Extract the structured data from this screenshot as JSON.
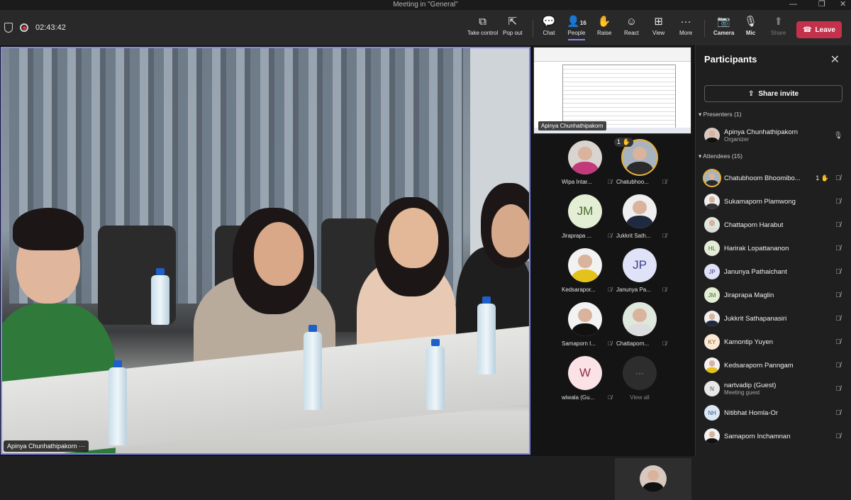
{
  "window": {
    "title": "Meeting in \"General\""
  },
  "toolbar": {
    "timer": "02:43:42",
    "buttons": {
      "take_control": "Take control",
      "pop_out": "Pop out",
      "chat": "Chat",
      "people": "People",
      "people_count": "16",
      "raise": "Raise",
      "react": "React",
      "view": "View",
      "more": "More",
      "camera": "Camera",
      "mic": "Mic",
      "share": "Share",
      "leave": "Leave"
    }
  },
  "main_video": {
    "name": "Apinya Chunhathipakorn"
  },
  "shared_screen": {
    "label": "Apinya Chunhathipakorn"
  },
  "gallery": [
    {
      "name": "Wipa Intar...",
      "initials": "",
      "raised": false,
      "hand_count": ""
    },
    {
      "name": "Chatubhoo...",
      "initials": "",
      "raised": true,
      "hand_count": "1"
    },
    {
      "name": "Jiraprapa ...",
      "initials": "JM",
      "raised": false,
      "hand_count": ""
    },
    {
      "name": "Jukkrit Sath...",
      "initials": "",
      "raised": false,
      "hand_count": ""
    },
    {
      "name": "Kedsarapor...",
      "initials": "",
      "raised": false,
      "hand_count": ""
    },
    {
      "name": "Janunya Pa...",
      "initials": "JP",
      "raised": false,
      "hand_count": ""
    },
    {
      "name": "Samaporn I...",
      "initials": "",
      "raised": false,
      "hand_count": ""
    },
    {
      "name": "Chattaporn...",
      "initials": "",
      "raised": false,
      "hand_count": ""
    },
    {
      "name": "wiwala (Gu...",
      "initials": "W",
      "raised": false,
      "hand_count": ""
    },
    {
      "name": "View all",
      "initials": "···",
      "raised": false,
      "hand_count": ""
    }
  ],
  "panel": {
    "title": "Participants",
    "share_invite": "Share invite",
    "presenters_header": "Presenters (1)",
    "attendees_header": "Attendees (15)",
    "presenters": [
      {
        "name": "Apinya Chunhathipakorn",
        "role": "Organizer",
        "initials": ""
      }
    ],
    "attendees": [
      {
        "name": "Chatubhoom Bhoomibo...",
        "role": "",
        "initials": "",
        "hand": "1"
      },
      {
        "name": "Sukamaporn Plamwong",
        "role": "",
        "initials": "",
        "hand": ""
      },
      {
        "name": "Chattaporn Harabut",
        "role": "",
        "initials": "",
        "hand": ""
      },
      {
        "name": "Harirak Lopattananon",
        "role": "",
        "initials": "HL",
        "hand": ""
      },
      {
        "name": "Janunya Pathaichant",
        "role": "",
        "initials": "JP",
        "hand": ""
      },
      {
        "name": "Jiraprapa Maglin",
        "role": "",
        "initials": "JM",
        "hand": ""
      },
      {
        "name": "Jukkrit Sathapanasiri",
        "role": "",
        "initials": "",
        "hand": ""
      },
      {
        "name": "Kamontip Yuyen",
        "role": "",
        "initials": "KY",
        "hand": ""
      },
      {
        "name": "Kedsaraporn Panngam",
        "role": "",
        "initials": "",
        "hand": ""
      },
      {
        "name": "nartvadip (Guest)",
        "role": "Meeting guest",
        "initials": "N",
        "hand": ""
      },
      {
        "name": "Nitibhat Homla-Or",
        "role": "",
        "initials": "NH",
        "hand": ""
      },
      {
        "name": "Samaporn Inchamnan",
        "role": "",
        "initials": "",
        "hand": ""
      }
    ]
  },
  "colors": {
    "accent": "#7f85f5",
    "leave": "#c4314b",
    "raise_ring": "#e8b13a"
  }
}
